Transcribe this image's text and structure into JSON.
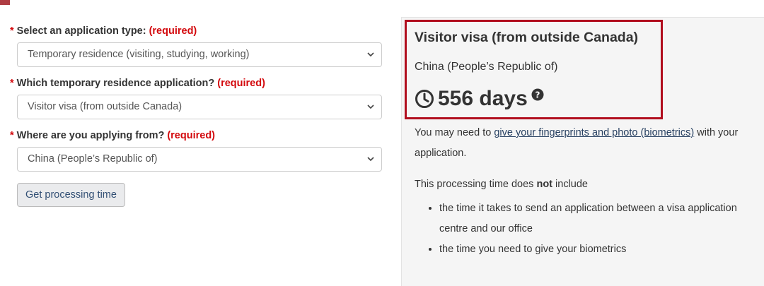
{
  "form": {
    "required_marker": "*",
    "required_text": "(required)",
    "fields": [
      {
        "label": "Select an application type:",
        "value": "Temporary residence (visiting, studying, working)"
      },
      {
        "label": "Which temporary residence application?",
        "value": "Visitor visa (from outside Canada)"
      },
      {
        "label": "Where are you applying from?",
        "value": "China (People’s Republic of)"
      }
    ],
    "submit_label": "Get processing time"
  },
  "result": {
    "title": "Visitor visa (from outside Canada)",
    "country": "China (People’s Republic of)",
    "days": "556 days",
    "biometrics_before": "You may need to ",
    "biometrics_link": "give your fingerprints and photo (biometrics)",
    "biometrics_after": " with your application.",
    "note_before": "This processing time does ",
    "note_bold": "not",
    "note_after": " include",
    "bullets": [
      "the time it takes to send an application between a visa application centre and our office",
      "the time you need to give your biometrics"
    ]
  },
  "icons": {
    "clock": "clock-icon",
    "help": "question-circle-icon",
    "dropdown": "chevron-down-icon"
  },
  "colors": {
    "required": "#d3080c",
    "highlight_border": "#b10e1e",
    "link": "#284162",
    "panel_bg": "#f5f5f5"
  }
}
